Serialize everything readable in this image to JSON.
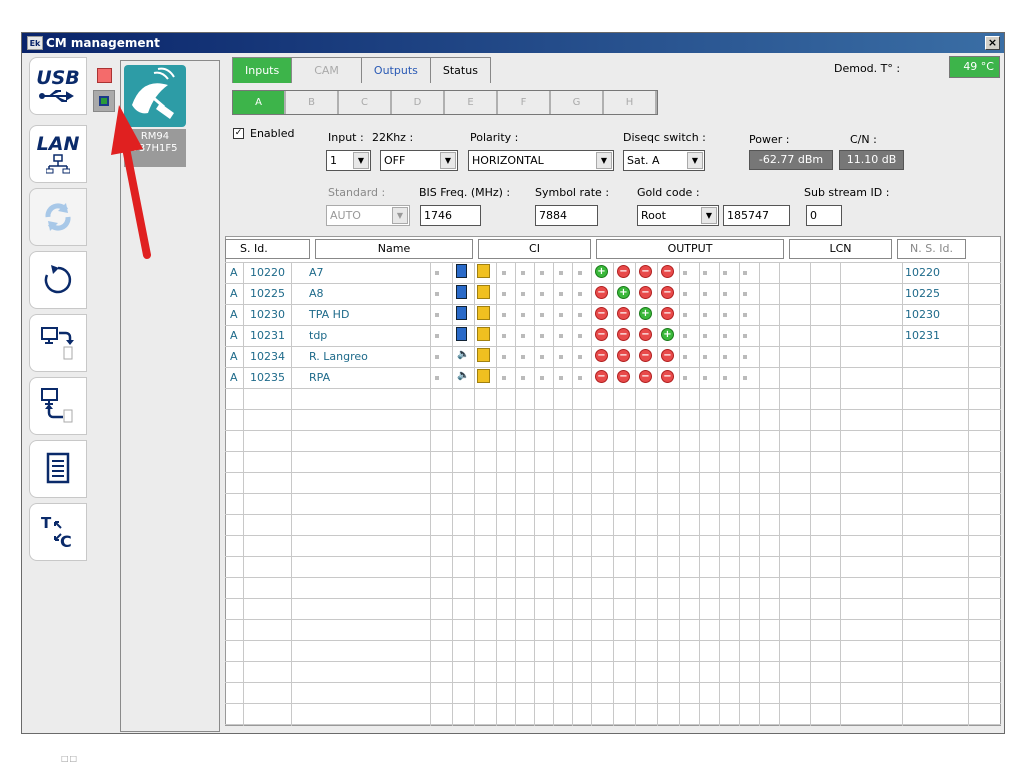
{
  "window": {
    "title": "CM management",
    "logo": "Ek",
    "close_label": "×"
  },
  "leftbar": {
    "usb_label": "USB",
    "lan_label": "LAN",
    "text_btn_label": "T"
  },
  "device": {
    "label_line1": "RM94",
    "label_line2": "737H1F5"
  },
  "tabs": {
    "inputs": "Inputs",
    "cam": "CAM",
    "outputs": "Outputs",
    "status": "Status"
  },
  "demod": {
    "label": "Demod. T° :",
    "value": "49 °C"
  },
  "input_tabs": [
    "A",
    "B",
    "C",
    "D",
    "E",
    "F",
    "G",
    "H"
  ],
  "form": {
    "enabled_label": "Enabled",
    "input_label": "Input :",
    "input_value": "1",
    "khz_label": "22Khz :",
    "khz_value": "OFF",
    "polarity_label": "Polarity :",
    "polarity_value": "HORIZONTAL",
    "diseqc_label": "Diseqc switch :",
    "diseqc_value": "Sat. A",
    "power_label": "Power :",
    "power_value": "-62.77 dBm",
    "cn_label": "C/N :",
    "cn_value": "11.10 dB",
    "standard_label": "Standard :",
    "standard_value": "AUTO",
    "bis_label": "BIS Freq. (MHz) :",
    "bis_value": "1746",
    "symbol_label": "Symbol rate :",
    "symbol_value": "7884",
    "gold_label": "Gold code :",
    "gold_value": "Root",
    "gold_num": "185747",
    "substream_label": "Sub stream ID :",
    "substream_value": "0"
  },
  "table": {
    "headers": {
      "sid": "S. Id.",
      "name": "Name",
      "ci": "CI",
      "output": "OUTPUT",
      "lcn": "LCN",
      "nsid": "N. S. Id."
    },
    "rows": [
      {
        "a": "A",
        "sid": "10220",
        "name": "A7",
        "type": "film",
        "out": [
          "g",
          "r",
          "r",
          "r"
        ],
        "nsid": "10220"
      },
      {
        "a": "A",
        "sid": "10225",
        "name": "A8",
        "type": "film",
        "out": [
          "r",
          "g",
          "r",
          "r"
        ],
        "nsid": "10225"
      },
      {
        "a": "A",
        "sid": "10230",
        "name": "TPA HD",
        "type": "film",
        "out": [
          "r",
          "r",
          "g",
          "r"
        ],
        "nsid": "10230"
      },
      {
        "a": "A",
        "sid": "10231",
        "name": "tdp",
        "type": "film",
        "out": [
          "r",
          "r",
          "r",
          "g"
        ],
        "nsid": "10231"
      },
      {
        "a": "A",
        "sid": "10234",
        "name": "R. Langreo",
        "type": "audio",
        "out": [
          "r",
          "r",
          "r",
          "r"
        ],
        "nsid": ""
      },
      {
        "a": "A",
        "sid": "10235",
        "name": "RPA",
        "type": "audio",
        "out": [
          "r",
          "r",
          "r",
          "r"
        ],
        "nsid": ""
      }
    ]
  },
  "status_dots": "□□"
}
